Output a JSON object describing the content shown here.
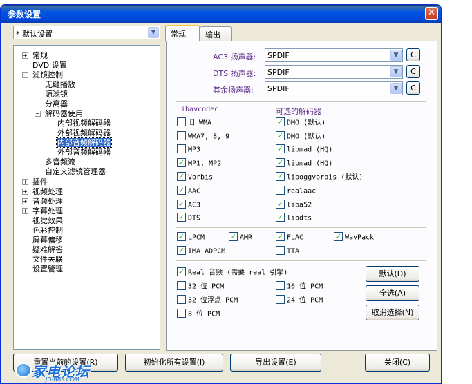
{
  "window": {
    "title": "参数设置",
    "close_glyph": "✕"
  },
  "preset": {
    "value": "* 默认设置",
    "arrow": "▼"
  },
  "tree": {
    "items": [
      {
        "label": "常规",
        "expander": "+"
      },
      {
        "label": "DVD 设置",
        "expander": ""
      },
      {
        "label": "滤镜控制",
        "expander": "−"
      },
      {
        "label": "无缝播放",
        "expander": ""
      },
      {
        "label": "源滤镜",
        "expander": ""
      },
      {
        "label": "分离器",
        "expander": ""
      },
      {
        "label": "解码器使用",
        "expander": "−"
      },
      {
        "label": "内部视频解码器",
        "expander": ""
      },
      {
        "label": "外部视频解码器",
        "expander": ""
      },
      {
        "label": "内部音频解码器",
        "expander": ""
      },
      {
        "label": "外部音频解码器",
        "expander": ""
      },
      {
        "label": "多音频流",
        "expander": ""
      },
      {
        "label": "自定义滤镜管理器",
        "expander": ""
      },
      {
        "label": "插件",
        "expander": "+"
      },
      {
        "label": "视频处理",
        "expander": "+"
      },
      {
        "label": "音频处理",
        "expander": "+"
      },
      {
        "label": "字幕处理",
        "expander": "+"
      },
      {
        "label": "视觉效果",
        "expander": ""
      },
      {
        "label": "色彩控制",
        "expander": ""
      },
      {
        "label": "屏幕偏移",
        "expander": ""
      },
      {
        "label": "疑难解答",
        "expander": ""
      },
      {
        "label": "文件关联",
        "expander": ""
      },
      {
        "label": "设置管理",
        "expander": ""
      }
    ]
  },
  "tabs": [
    {
      "label": "常规"
    },
    {
      "label": "输出"
    }
  ],
  "speakers": [
    {
      "label": "AC3 扬声器:",
      "value": "SPDIF",
      "button": "C"
    },
    {
      "label": "DTS 扬声器:",
      "value": "SPDIF",
      "button": "C"
    },
    {
      "label": "其余扬声器:",
      "value": "SPDIF",
      "button": "C"
    }
  ],
  "check_glyph": "✓",
  "libavcodec": {
    "header": "Libavcodec",
    "items": [
      {
        "label": "旧 WMA",
        "checked": false
      },
      {
        "label": "WMA7, 8, 9",
        "checked": false
      },
      {
        "label": "MP3",
        "checked": false
      },
      {
        "label": "MP1, MP2",
        "checked": true
      },
      {
        "label": "Vorbis",
        "checked": true
      },
      {
        "label": "AAC",
        "checked": true
      },
      {
        "label": "AC3",
        "checked": true
      },
      {
        "label": "DTS",
        "checked": true
      }
    ]
  },
  "optional": {
    "header": "可选的解码器",
    "items": [
      {
        "label": "DMO (默认)",
        "checked": true
      },
      {
        "label": "DMO (默认)",
        "checked": true
      },
      {
        "label": "libmad (HQ)",
        "checked": true
      },
      {
        "label": "libmad (HQ)",
        "checked": true
      },
      {
        "label": "liboggvorbis (默认)",
        "checked": true
      },
      {
        "label": "realaac",
        "checked": false
      },
      {
        "label": "liba52",
        "checked": true
      },
      {
        "label": "libdts",
        "checked": true
      }
    ]
  },
  "formats": [
    {
      "label": "LPCM",
      "checked": true
    },
    {
      "label": "AMR",
      "checked": true
    },
    {
      "label": "FLAC",
      "checked": true
    },
    {
      "label": "WavPack",
      "checked": true
    },
    {
      "label": "IMA ADPCM",
      "checked": true
    },
    {
      "label": "TTA",
      "checked": false
    }
  ],
  "pcm": [
    {
      "label": "Real 音频 (需要 real 引擎)",
      "checked": true
    },
    {
      "label": "32 位 PCM",
      "checked": false
    },
    {
      "label": "16 位 PCM",
      "checked": false
    },
    {
      "label": "32 位浮点 PCM",
      "checked": false
    },
    {
      "label": "24 位 PCM",
      "checked": false
    },
    {
      "label": "8 位 PCM",
      "checked": false
    }
  ],
  "side_buttons": {
    "default": "默认(D)",
    "select_all": "全选(A)",
    "deselect": "取消选择(N)"
  },
  "bottom_buttons": {
    "reset": "重置当前的设置(R)",
    "init": "初始化所有设置(I)",
    "export": "导出设置(E)",
    "close": "关闭(C)"
  },
  "watermark": {
    "text": "家电论坛",
    "url": "JD-BBS.COM"
  }
}
